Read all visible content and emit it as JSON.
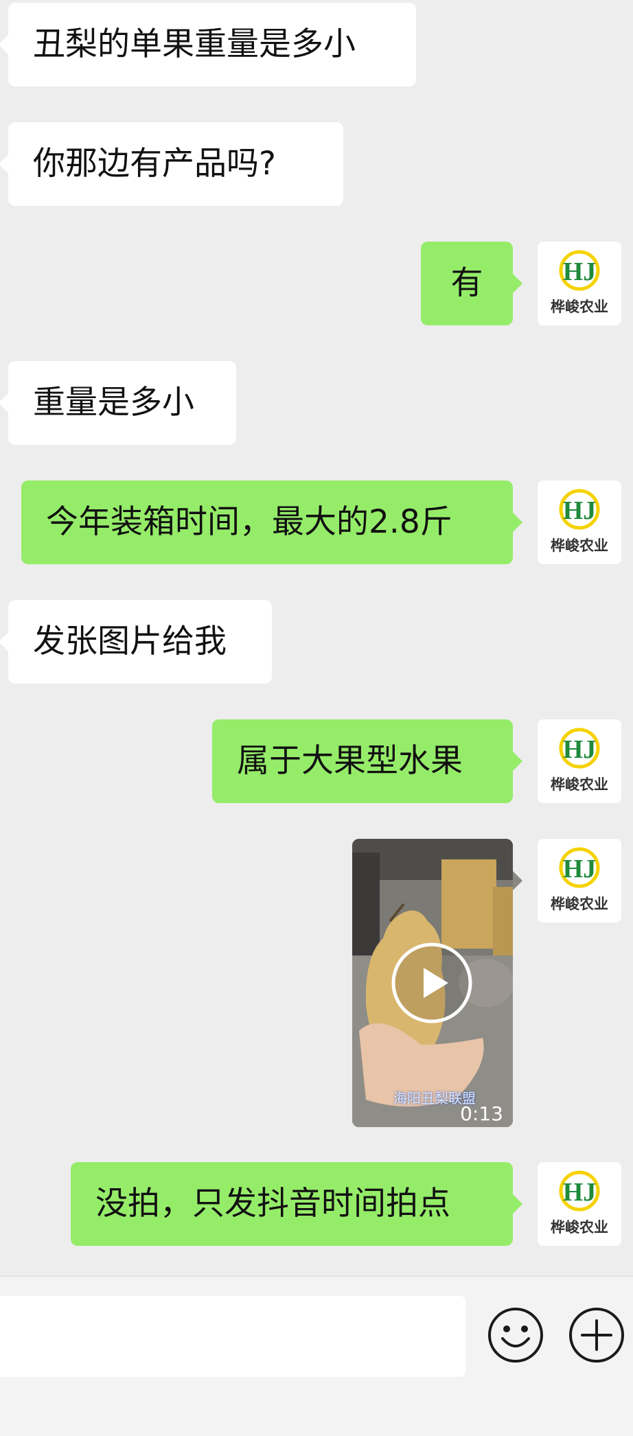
{
  "avatar": {
    "brand_text": "桦峻农业",
    "logo_letters": "HJ",
    "colors": {
      "green": "#1f8a3c",
      "yellow": "#f5d200"
    }
  },
  "messages": [
    {
      "side": "left",
      "type": "text",
      "text": "丑梨的单果重量是多小"
    },
    {
      "side": "left",
      "type": "text",
      "text": "你那边有产品吗?"
    },
    {
      "side": "right",
      "type": "text",
      "text": "有"
    },
    {
      "side": "left",
      "type": "text",
      "text": "重量是多小"
    },
    {
      "side": "right",
      "type": "text",
      "text": "今年装箱时间，最大的2.8斤"
    },
    {
      "side": "left",
      "type": "text",
      "text": "发张图片给我"
    },
    {
      "side": "right",
      "type": "text",
      "text": "属于大果型水果"
    },
    {
      "side": "right",
      "type": "video",
      "watermark": "海阳丑梨联盟",
      "duration": "0:13"
    },
    {
      "side": "right",
      "type": "text",
      "text": "没拍，只发抖音时间拍点"
    }
  ],
  "input_bar": {
    "value": "",
    "emoji_icon": "emoji-icon",
    "add_icon": "plus-circle-icon"
  },
  "colors": {
    "background": "#ededed",
    "bubble_self": "#95ec69",
    "bubble_other": "#ffffff"
  }
}
